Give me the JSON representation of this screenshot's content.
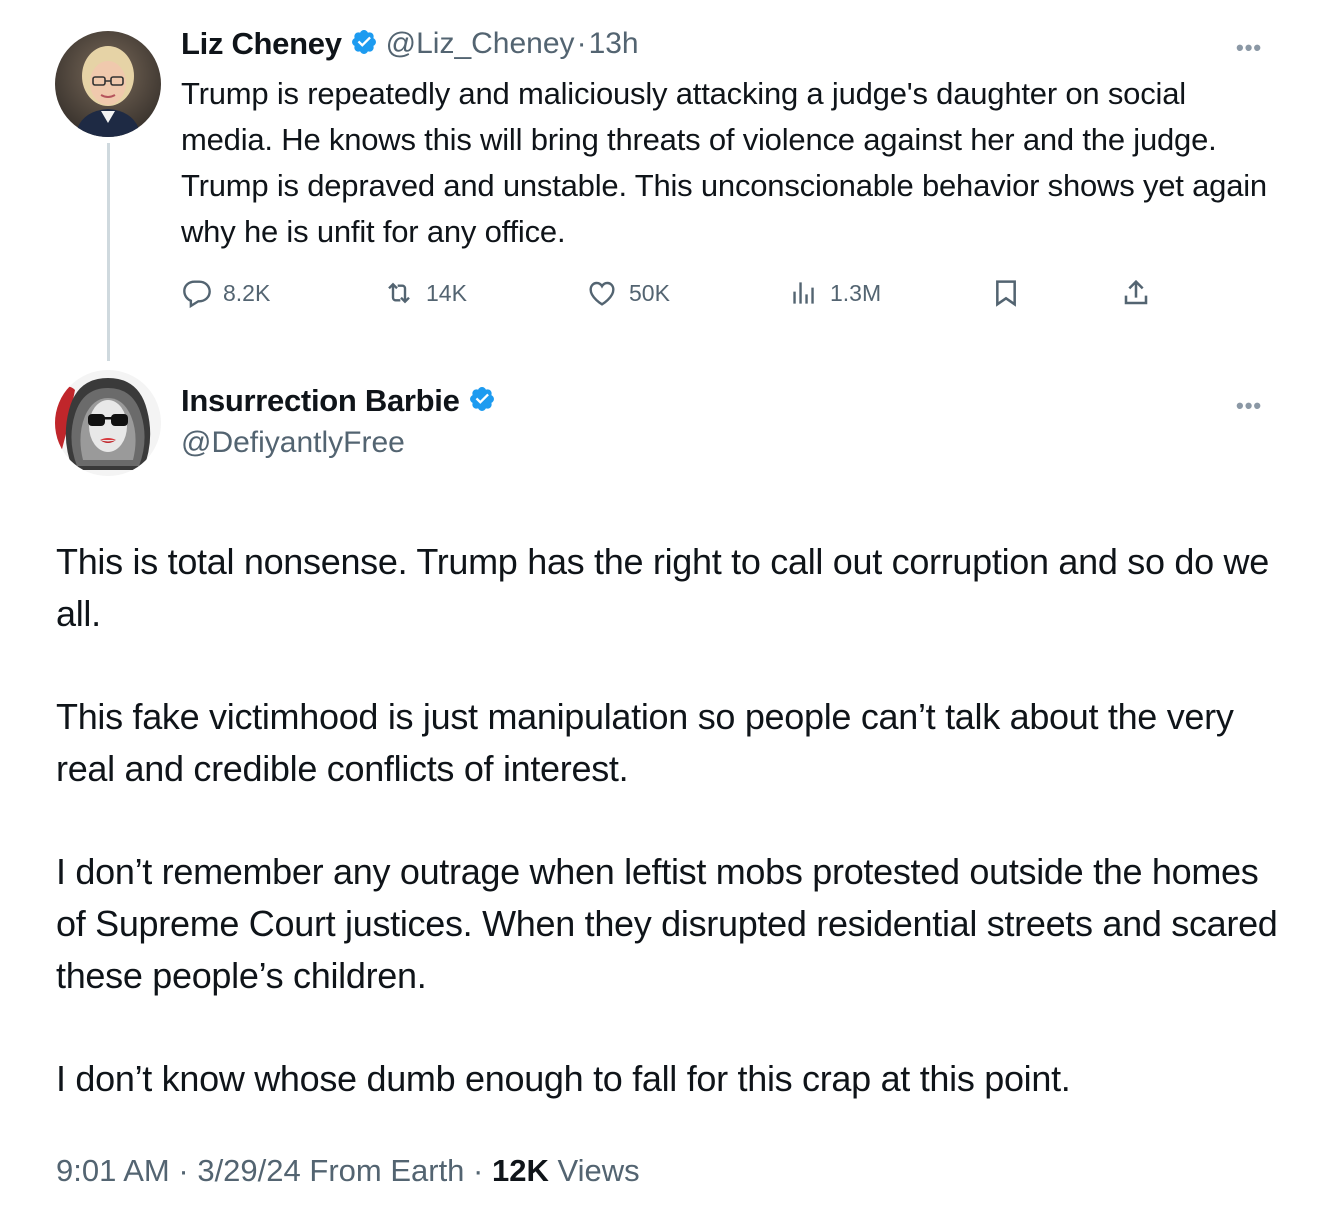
{
  "parent_tweet": {
    "author_name": "Liz Cheney",
    "handle": "@Liz_Cheney",
    "separator": "·",
    "time": "13h",
    "text": "Trump is repeatedly and maliciously attacking a judge's daughter on social media. He knows this will bring threats of violence against her and the judge. Trump is depraved and unstable. This unconscionable behavior shows yet again why he is unfit for any office.",
    "actions": {
      "replies": "8.2K",
      "reposts": "14K",
      "likes": "50K",
      "views": "1.3M"
    },
    "more_label": "•••"
  },
  "reply_tweet": {
    "author_name": "Insurrection Barbie",
    "handle": "@DefiyantlyFree",
    "more_label": "•••",
    "paragraphs": [
      "This is total nonsense. Trump has the right to call out corruption and so do we all.",
      "This fake victimhood is just manipulation so people can’t talk about the very real and credible conflicts of interest.",
      "I don’t remember any outrage when leftist mobs protested outside the homes of Supreme Court justices. When they disrupted residential streets and scared these people’s children.",
      "I don’t know whose dumb enough to fall for this crap at this point."
    ],
    "meta": {
      "time": "9:01 AM",
      "separator": "·",
      "date": "3/29/24",
      "source": "From Earth",
      "separator2": "·",
      "views_count": "12K",
      "views_label": "Views"
    }
  },
  "colors": {
    "verified_blue": "#1d9bf0",
    "secondary_text": "#536471",
    "primary_text": "#0f1419",
    "thread_line": "#cfd9de"
  },
  "icons": [
    "verified-badge-icon",
    "reply-icon",
    "repost-icon",
    "like-icon",
    "views-icon",
    "bookmark-icon",
    "share-icon",
    "more-icon"
  ]
}
